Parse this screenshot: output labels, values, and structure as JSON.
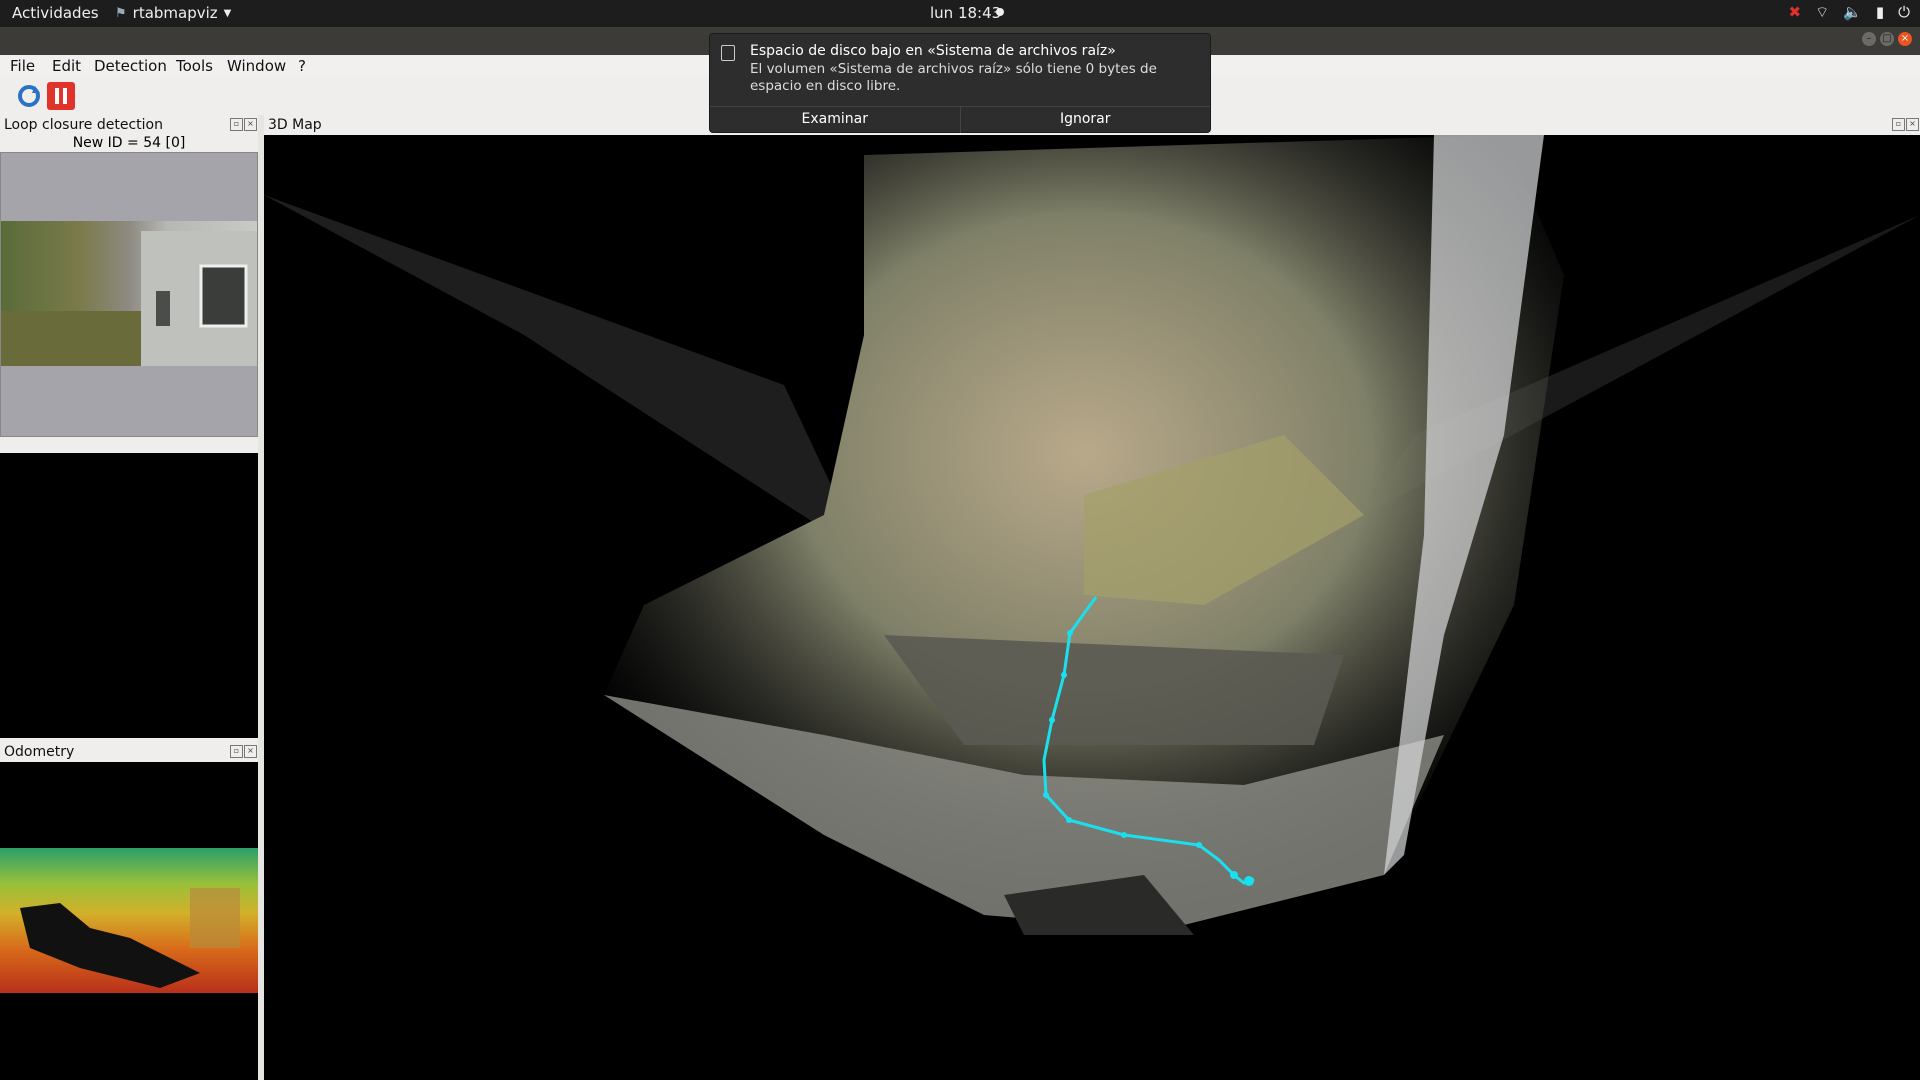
{
  "topbar": {
    "activities": "Actividades",
    "app_name": "rtabmapviz",
    "clock": "lun 18:43"
  },
  "menu": [
    "File",
    "Edit",
    "Detection",
    "Tools",
    "Window",
    "?"
  ],
  "docks": {
    "loop_title": "Loop closure detection",
    "loop_new_id": "New ID = 54 [0]",
    "odometry_title": "Odometry",
    "map_title": "3D Map"
  },
  "notification": {
    "title": "Espacio de disco bajo en «Sistema de archivos raíz»",
    "body": "El volumen «Sistema de archivos raíz» sólo tiene 0 bytes de espacio en disco libre.",
    "action_examine": "Examinar",
    "action_ignore": "Ignorar"
  },
  "colors": {
    "trajectory": "#19e0ee",
    "pause_button": "#e0332a",
    "refresh_button": "#2a73c4"
  },
  "icons": [
    "refresh-icon",
    "pause-icon",
    "network-icon",
    "volume-icon",
    "battery-icon",
    "power-icon"
  ]
}
